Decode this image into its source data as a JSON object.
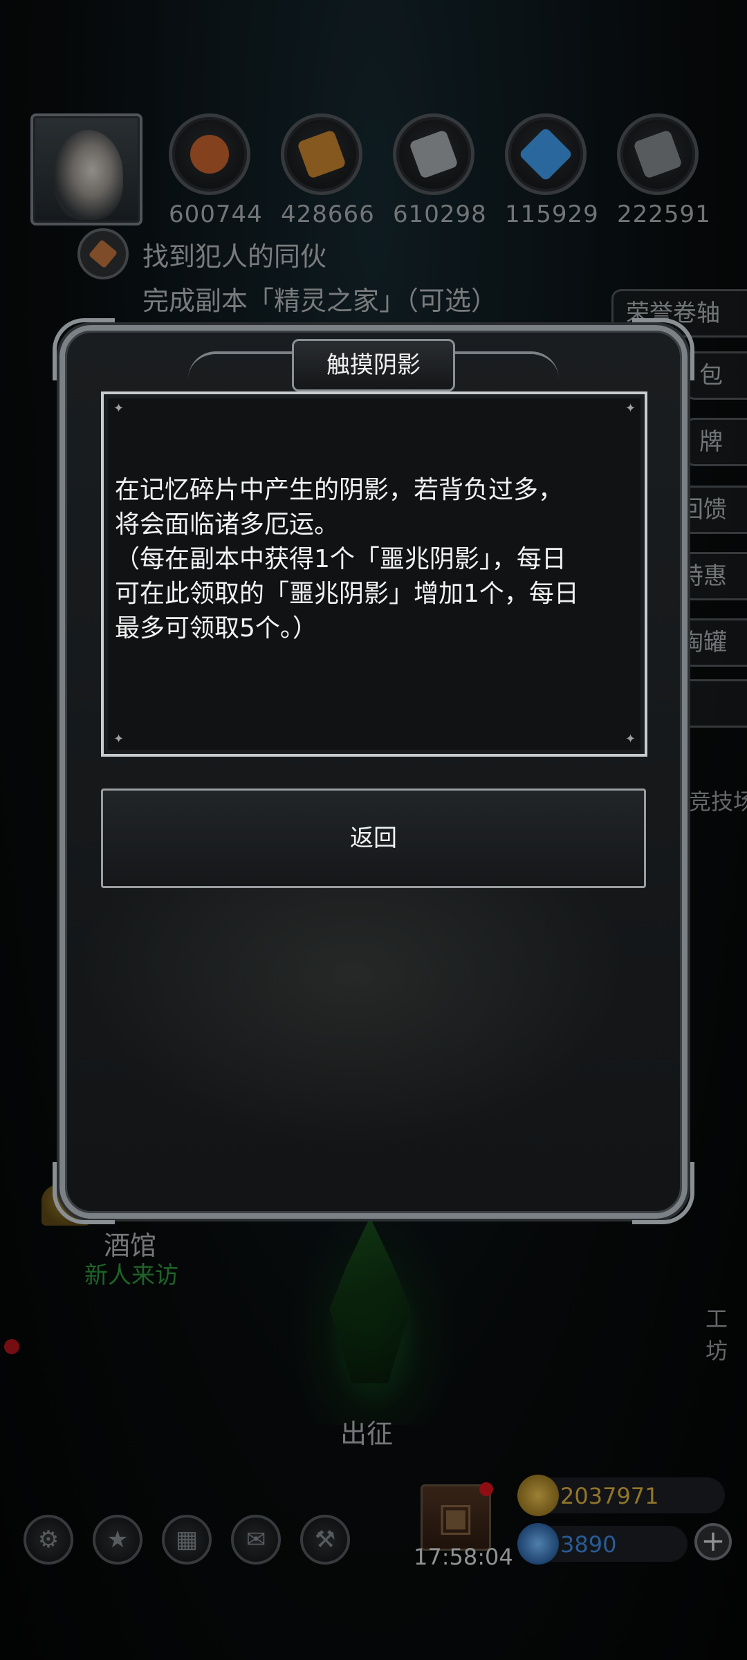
{
  "resources": [
    {
      "value": "600744",
      "icon": "meat-icon",
      "color": "#b85a2a"
    },
    {
      "value": "428666",
      "icon": "wood-icon",
      "color": "#b87a2a"
    },
    {
      "value": "610298",
      "icon": "iron-icon",
      "color": "#9a9ea1"
    },
    {
      "value": "115929",
      "icon": "crystal-icon",
      "color": "#3a8fd8"
    },
    {
      "value": "222591",
      "icon": "stone-icon",
      "color": "#7a7e82"
    }
  ],
  "quest": {
    "title": "找到犯人的同伙",
    "description": "完成副本「精灵之家」（可选）"
  },
  "side_menu": [
    {
      "label": "荣誉卷轴"
    },
    {
      "label": "包"
    },
    {
      "label": "牌"
    },
    {
      "label": "回馈"
    },
    {
      "label": "特惠"
    },
    {
      "label": "陶罐"
    }
  ],
  "side_labels": {
    "arena": "竞技场",
    "workshop": "工坊"
  },
  "tavern": {
    "label": "酒馆",
    "sub": "新人来访"
  },
  "expedition": {
    "label": "出征"
  },
  "bottom_bar": {
    "icons": [
      "gear-icon",
      "star-icon",
      "map-icon",
      "mail-icon",
      "forge-icon"
    ],
    "clock": "17:58:04",
    "gold": "2037971",
    "gems": "3890",
    "plus": "+"
  },
  "dialog": {
    "title": "触摸阴影",
    "body": "在记忆碎片中产生的阴影，若背负过多，\n将会面临诸多厄运。\n（每在副本中获得1个「噩兆阴影」，每日\n可在此领取的「噩兆阴影」增加1个，每日\n最多可领取5个。）",
    "back_label": "返回"
  },
  "colors": {
    "gold": "#c9a23a",
    "gem": "#3a7fd0",
    "tavern_sub": "#2a8a3a"
  }
}
